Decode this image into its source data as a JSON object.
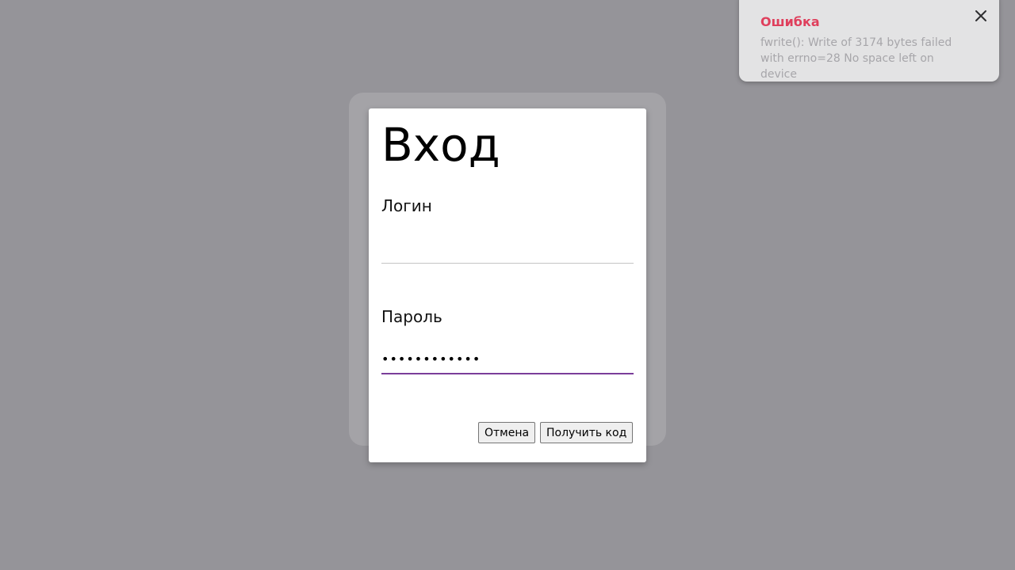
{
  "dialog": {
    "title": "Вход",
    "login_label": "Логин",
    "login_value": "",
    "password_label": "Пароль",
    "password_value": "............",
    "cancel_label": "Отмена",
    "submit_label": "Получить код"
  },
  "toast": {
    "title": "Ошибка",
    "message": "fwrite(): Write of 3174 bytes failed with errno=28 No space left on device",
    "close_icon": "close-icon"
  },
  "colors": {
    "overlay": "#959499",
    "error_title": "#df3f5c",
    "focus_underline": "#7a3e9a"
  }
}
